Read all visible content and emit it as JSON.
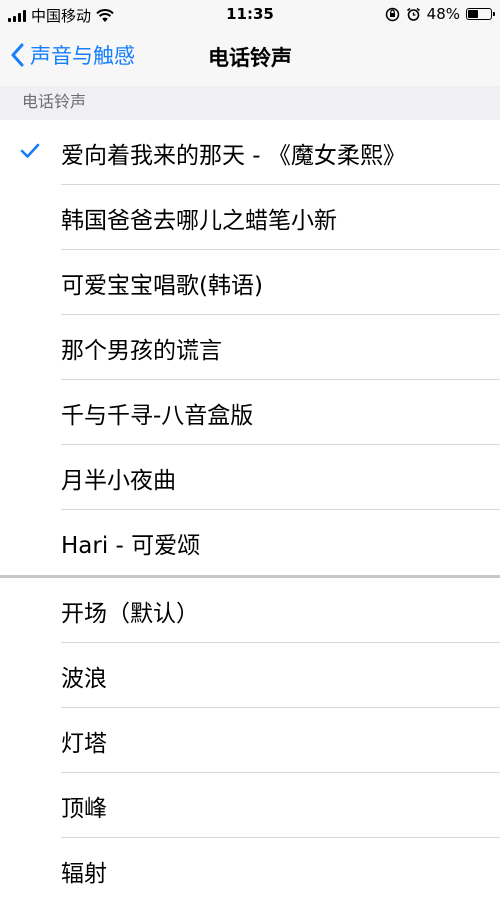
{
  "status_bar": {
    "carrier": "中国移动",
    "time": "11:35",
    "battery_percent": "48%",
    "battery_level": 0.48
  },
  "nav": {
    "back_label": "声音与触感",
    "title": "电话铃声"
  },
  "section_header": "电话铃声",
  "custom_ringtones": [
    {
      "label": "爱向着我来的那天 - 《魔女柔熙》",
      "selected": true
    },
    {
      "label": "韩国爸爸去哪儿之蜡笔小新"
    },
    {
      "label": "可爱宝宝唱歌(韩语)"
    },
    {
      "label": "那个男孩的谎言"
    },
    {
      "label": "千与千寻-八音盒版"
    },
    {
      "label": "月半小夜曲"
    },
    {
      "label": "Hari - 可爱颂"
    }
  ],
  "system_ringtones": [
    {
      "label": "开场（默认）"
    },
    {
      "label": "波浪"
    },
    {
      "label": "灯塔"
    },
    {
      "label": "顶峰"
    },
    {
      "label": "辐射"
    }
  ],
  "colors": {
    "accent": "#147efb",
    "background": "#efeff4"
  }
}
